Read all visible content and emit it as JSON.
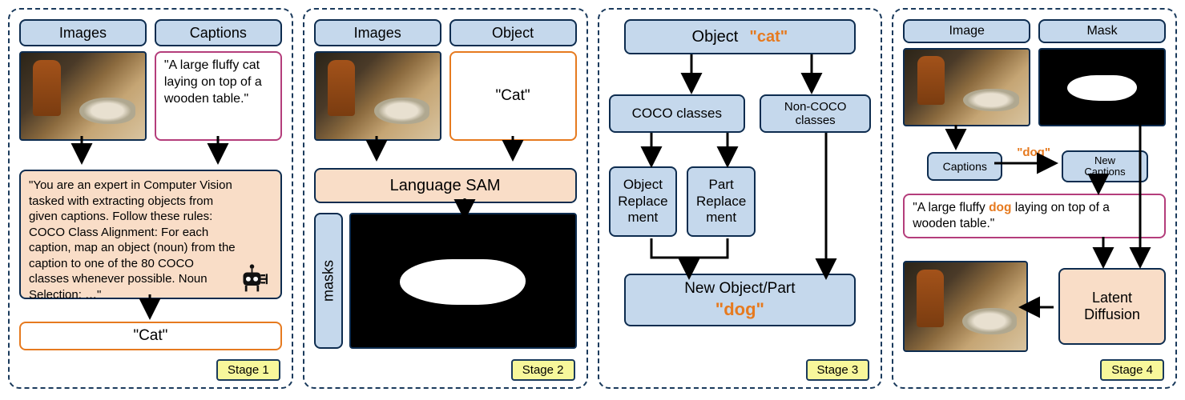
{
  "accent": {
    "orange": "#e67a1f",
    "navy": "#0d2c4f",
    "blue": "#c5d8ec",
    "peach": "#f9ddc7",
    "yellow": "#f7f79b",
    "magenta": "#b43d7b"
  },
  "stage1": {
    "label": "Stage 1",
    "images": "Images",
    "captions": "Captions",
    "caption_text": "\"A large fluffy cat laying on top of a wooden table.\"",
    "prompt": "\"You are an expert in Computer Vision tasked with extracting objects from given captions. Follow these rules: COCO Class Alignment: For each caption, map an object (noun) from the caption to one of the 80 COCO classes whenever possible. Noun Selection: …\"",
    "result": "\"Cat\""
  },
  "stage2": {
    "label": "Stage 2",
    "images": "Images",
    "object": "Object",
    "object_value": "\"Cat\"",
    "model": "Language SAM",
    "masks": "masks"
  },
  "stage3": {
    "label": "Stage 3",
    "object": "Object",
    "object_value": "\"cat\"",
    "coco": "COCO classes",
    "noncoco": "Non-COCO classes",
    "replace_obj": "Object Replace​ment",
    "replace_part": "Part Replace​ment",
    "new_label": "New Object/Part",
    "new_value": "\"dog\""
  },
  "stage4": {
    "label": "Stage 4",
    "image": "Image",
    "mask": "Mask",
    "captions": "Captions",
    "swap": "\"dog\"",
    "new_captions": "New Captions",
    "caption_prefix": "\"A large fluffy ",
    "caption_hl": "dog",
    "caption_suffix": " laying on top of a wooden table.\"",
    "model": "Latent Diffusion"
  }
}
